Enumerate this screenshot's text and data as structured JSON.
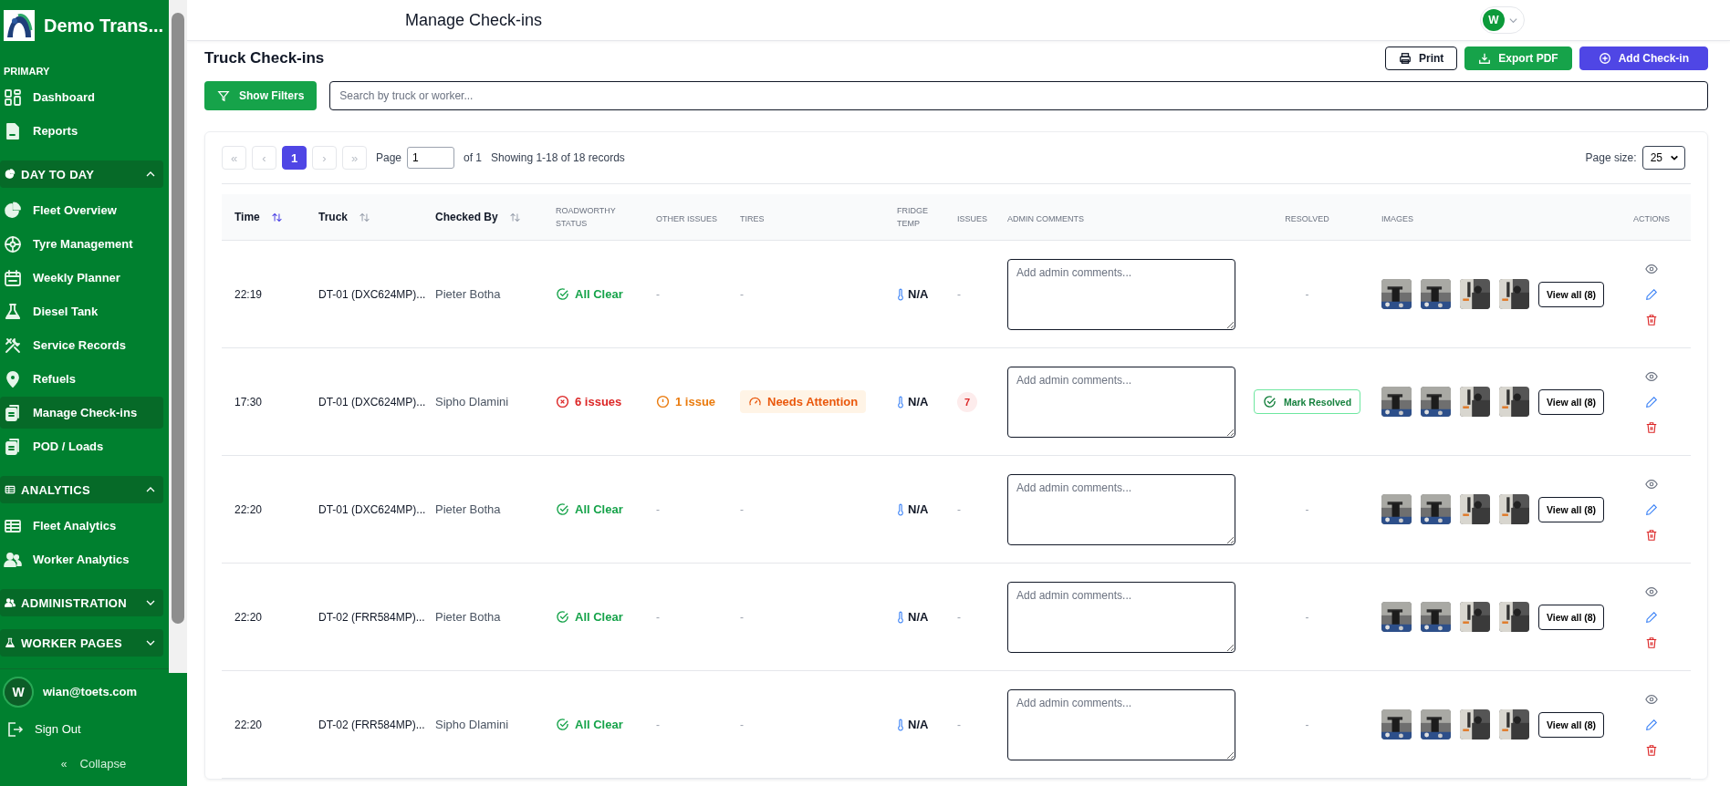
{
  "sidebar": {
    "brand": "Demo Trans...",
    "sections": [
      {
        "title": "PRIMARY",
        "kind": "plain",
        "items": [
          {
            "label": "Dashboard",
            "selected": false
          },
          {
            "label": "Reports",
            "selected": false
          }
        ]
      },
      {
        "title": "DAY TO DAY",
        "kind": "group",
        "expanded": true,
        "items": [
          {
            "label": "Fleet Overview",
            "selected": false
          },
          {
            "label": "Tyre Management",
            "selected": false
          },
          {
            "label": "Weekly Planner",
            "selected": false
          },
          {
            "label": "Diesel Tank",
            "selected": false
          },
          {
            "label": "Service Records",
            "selected": false
          },
          {
            "label": "Refuels",
            "selected": false
          },
          {
            "label": "Manage Check-ins",
            "selected": true
          },
          {
            "label": "POD / Loads",
            "selected": false
          }
        ]
      },
      {
        "title": "ANALYTICS",
        "kind": "group",
        "expanded": true,
        "items": [
          {
            "label": "Fleet Analytics",
            "selected": false
          },
          {
            "label": "Worker Analytics",
            "selected": false
          }
        ]
      },
      {
        "title": "ADMINISTRATION",
        "kind": "group",
        "expanded": false
      },
      {
        "title": "WORKER PAGES",
        "kind": "group",
        "expanded": false
      }
    ],
    "user": {
      "initial": "W",
      "email": "wian@toets.com"
    },
    "sign_out": "Sign Out",
    "collapse": {
      "arrow": "«",
      "label": "Collapse"
    }
  },
  "header": {
    "title": "Manage Check-ins",
    "avatar": "W"
  },
  "page": {
    "title": "Truck Check-ins",
    "actions": [
      {
        "label": "Print",
        "kind": "outline"
      },
      {
        "label": "Export PDF",
        "kind": "green"
      },
      {
        "label": "Add Check-in",
        "kind": "purple"
      }
    ]
  },
  "filters": {
    "button": "Show Filters",
    "search": {
      "placeholder": "Search by truck or worker..."
    }
  },
  "pagination": {
    "buttons": [
      {
        "label": "«",
        "selected": false,
        "disabled": true
      },
      {
        "label": "‹",
        "selected": false,
        "disabled": true
      },
      {
        "label": "1",
        "selected": true,
        "disabled": false
      },
      {
        "label": "›",
        "selected": false,
        "disabled": true
      },
      {
        "label": "»",
        "selected": false,
        "disabled": true
      }
    ],
    "page_label": "Page",
    "page_value": "1",
    "of": "of 1",
    "showing": "Showing 1-18 of 18 records",
    "size_label": "Page size:",
    "size_value": "25"
  },
  "table": {
    "columns": [
      {
        "label": "Time",
        "kind": "sortable",
        "selected": true
      },
      {
        "label": "Truck",
        "kind": "sortable",
        "selected": false
      },
      {
        "label": "Checked By",
        "kind": "sortable",
        "selected": false
      },
      {
        "label": "ROADWORTHY STATUS",
        "kind": "plain"
      },
      {
        "label": "OTHER ISSUES",
        "kind": "plain"
      },
      {
        "label": "TIRES",
        "kind": "plain"
      },
      {
        "label": "FRIDGE TEMP",
        "kind": "plain"
      },
      {
        "label": "ISSUES",
        "kind": "plain"
      },
      {
        "label": "ADMIN COMMENTS",
        "kind": "plain"
      },
      {
        "label": "RESOLVED",
        "kind": "center"
      },
      {
        "label": "IMAGES",
        "kind": "plain"
      },
      {
        "label": "ACTIONS",
        "kind": "center"
      }
    ],
    "rows": [
      {
        "time": "22:19",
        "truck": "DT-01 (DXC624MP)...",
        "checked_by": "Pieter Botha",
        "roadworthy": {
          "kind": "clear",
          "text": "All Clear"
        },
        "other_issues": {
          "kind": "none",
          "text": "-"
        },
        "tires": {
          "kind": "none",
          "text": "-"
        },
        "fridge_temp": "N/A",
        "issues": {
          "kind": "none",
          "text": "-"
        },
        "comment_placeholder": "Add admin comments...",
        "resolved": {
          "kind": "none",
          "text": "-"
        },
        "view_all": "View all (8)"
      },
      {
        "time": "17:30",
        "truck": "DT-01 (DXC624MP)...",
        "checked_by": "Sipho Dlamini",
        "roadworthy": {
          "kind": "issues",
          "text": "6 issues"
        },
        "other_issues": {
          "kind": "issue",
          "text": "1 issue"
        },
        "tires": {
          "kind": "attention",
          "text": "Needs Attention"
        },
        "fridge_temp": "N/A",
        "issues": {
          "kind": "count",
          "text": "7"
        },
        "comment_placeholder": "Add admin comments...",
        "resolved": {
          "kind": "button",
          "text": "Mark Resolved"
        },
        "view_all": "View all (8)"
      },
      {
        "time": "22:20",
        "truck": "DT-01 (DXC624MP)...",
        "checked_by": "Pieter Botha",
        "roadworthy": {
          "kind": "clear",
          "text": "All Clear"
        },
        "other_issues": {
          "kind": "none",
          "text": "-"
        },
        "tires": {
          "kind": "none",
          "text": "-"
        },
        "fridge_temp": "N/A",
        "issues": {
          "kind": "none",
          "text": "-"
        },
        "comment_placeholder": "Add admin comments...",
        "resolved": {
          "kind": "none",
          "text": "-"
        },
        "view_all": "View all (8)"
      },
      {
        "time": "22:20",
        "truck": "DT-02 (FRR584MP)...",
        "checked_by": "Pieter Botha",
        "roadworthy": {
          "kind": "clear",
          "text": "All Clear"
        },
        "other_issues": {
          "kind": "none",
          "text": "-"
        },
        "tires": {
          "kind": "none",
          "text": "-"
        },
        "fridge_temp": "N/A",
        "issues": {
          "kind": "none",
          "text": "-"
        },
        "comment_placeholder": "Add admin comments...",
        "resolved": {
          "kind": "none",
          "text": "-"
        },
        "view_all": "View all (8)"
      },
      {
        "time": "22:20",
        "truck": "DT-02 (FRR584MP)...",
        "checked_by": "Sipho Dlamini",
        "roadworthy": {
          "kind": "clear",
          "text": "All Clear"
        },
        "other_issues": {
          "kind": "none",
          "text": "-"
        },
        "tires": {
          "kind": "none",
          "text": "-"
        },
        "fridge_temp": "N/A",
        "issues": {
          "kind": "none",
          "text": "-"
        },
        "comment_placeholder": "Add admin comments...",
        "resolved": {
          "kind": "none",
          "text": "-"
        },
        "view_all": "View all (8)"
      }
    ]
  }
}
